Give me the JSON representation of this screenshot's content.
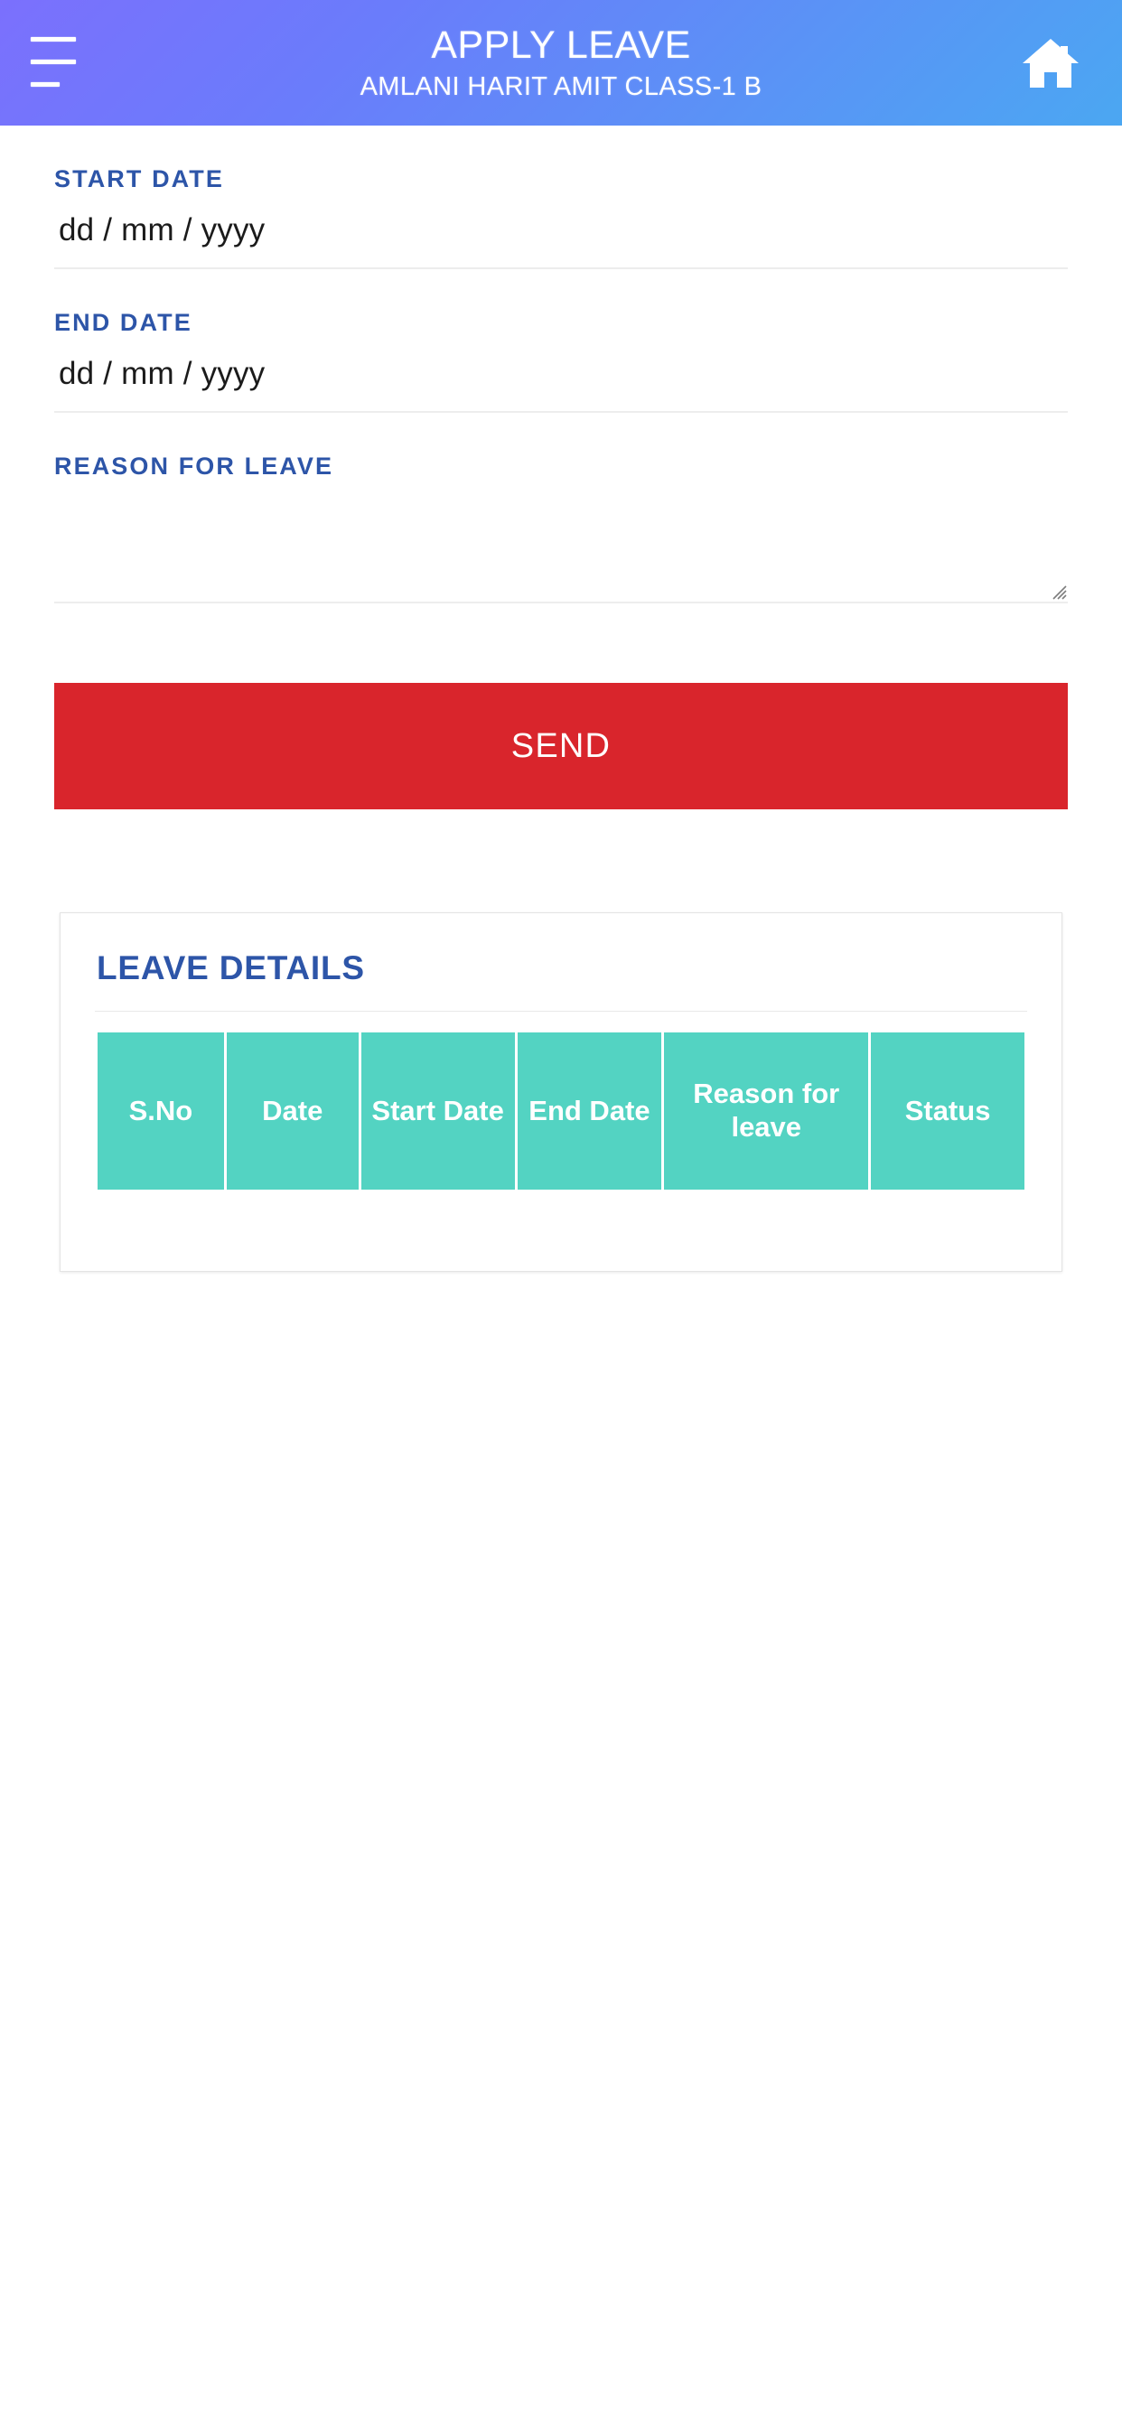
{
  "appbar": {
    "title": "APPLY LEAVE",
    "subtitle": "AMLANI HARIT AMIT CLASS-1 B",
    "menu_icon": "hamburger-menu-icon",
    "home_icon": "home-icon",
    "gradient_start": "#7b70fd",
    "gradient_end": "#4ba7f2"
  },
  "form": {
    "start_date": {
      "label": "START DATE",
      "value": "dd / mm / yyyy",
      "placeholder": "dd / mm / yyyy"
    },
    "end_date": {
      "label": "END DATE",
      "value": "dd / mm / yyyy",
      "placeholder": "dd / mm / yyyy"
    },
    "reason": {
      "label": "REASON FOR LEAVE",
      "value": "",
      "placeholder": ""
    },
    "label_color": "#2d55a8"
  },
  "actions": {
    "send_label": "SEND",
    "send_color": "#d9252c"
  },
  "leave_details": {
    "title": "LEAVE DETAILS",
    "header_color": "#53d3c2",
    "columns": [
      {
        "label": "S.No"
      },
      {
        "label": "Date"
      },
      {
        "label": "Start Date"
      },
      {
        "label": "End Date"
      },
      {
        "label": "Reason for leave"
      },
      {
        "label": "Status"
      }
    ],
    "rows": []
  }
}
